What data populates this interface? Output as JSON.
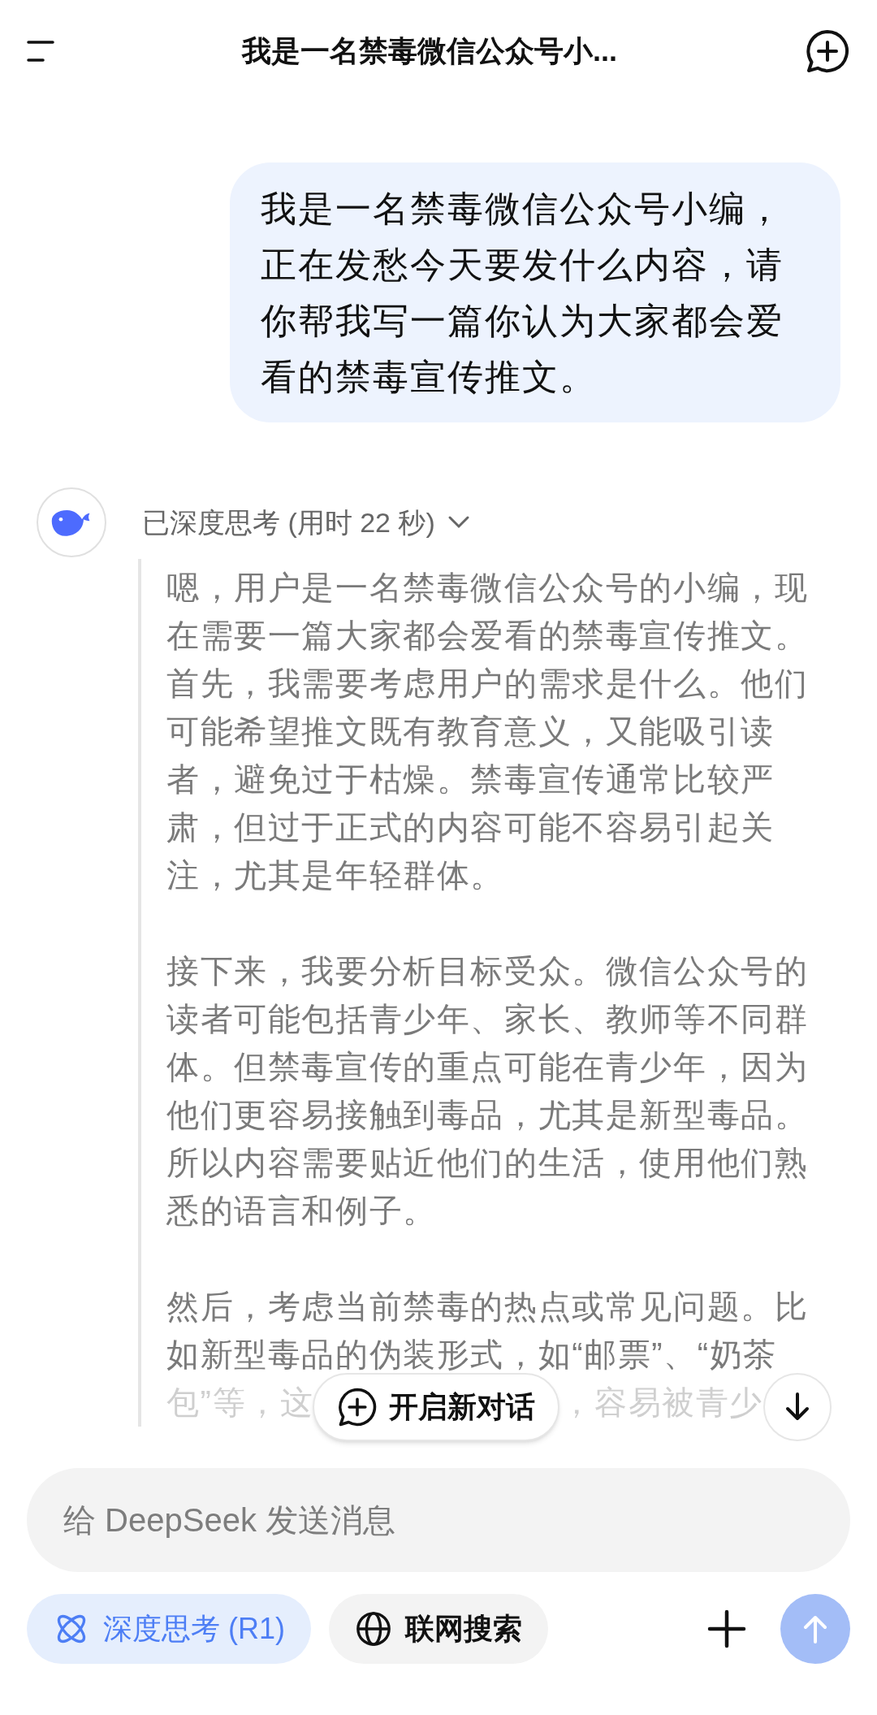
{
  "header": {
    "title": "我是一名禁毒微信公众号小..."
  },
  "user_message": {
    "text": "我是一名禁毒微信公众号小编，正在发愁今天要发什么内容，请你帮我写一篇你认为大家都会爱看的禁毒宣传推文。"
  },
  "assistant": {
    "thinking": {
      "label": "已深度思考 (用时 22 秒)",
      "expanded": true,
      "paragraphs": [
        "嗯，用户是一名禁毒微信公众号的小编，现在需要一篇大家都会爱看的禁毒宣传推文。首先，我需要考虑用户的需求是什么。他们可能希望推文既有教育意义，又能吸引读者，避免过于枯燥。禁毒宣传通常比较严肃，但过于正式的内容可能不容易引起关注，尤其是年轻群体。",
        "接下来，我要分析目标受众。微信公众号的读者可能包括青少年、家长、教师等不同群体。但禁毒宣传的重点可能在青少年，因为他们更容易接触到毒品，尤其是新型毒品。所以内容需要贴近他们的生活，使用他们熟悉的语言和例子。"
      ],
      "cut_paragraph": {
        "lines": [
          "然后，考虑当前禁毒的热点或常见问题。比",
          "如新型毒品的伪装形式，如“邮票”、“奶茶"
        ],
        "faded_parts": [
          "包”等，这",
          "，容易被青少"
        ]
      }
    }
  },
  "new_chat_button": {
    "label": "开启新对话"
  },
  "composer": {
    "placeholder": "给 DeepSeek 发送消息",
    "toggles": [
      {
        "kind": "think",
        "label": "深度思考 (R1)",
        "on": true
      },
      {
        "kind": "search",
        "label": "联网搜索",
        "on": false
      }
    ],
    "send_disabled": true
  }
}
